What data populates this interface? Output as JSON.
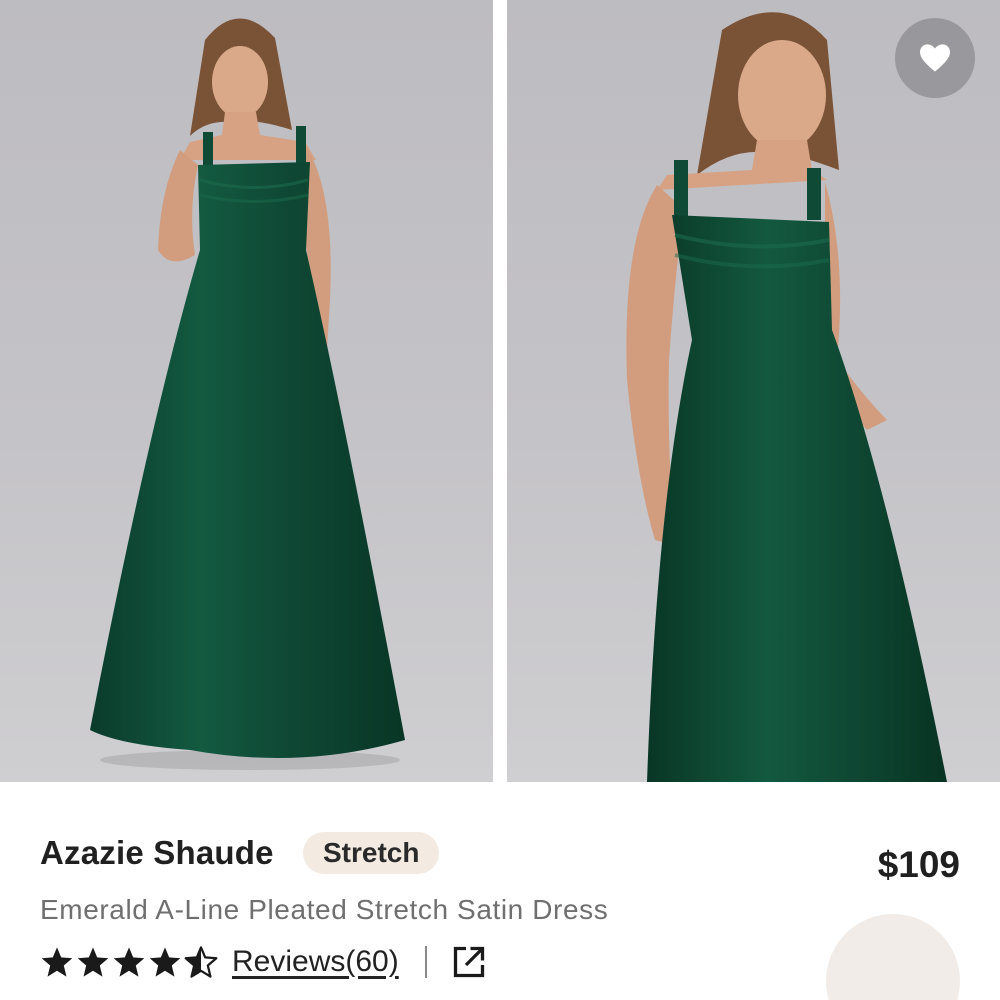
{
  "product": {
    "brand": "Azazie Shaude",
    "tag": "Stretch",
    "price": "$109",
    "title": "Emerald A-Line Pleated Stretch Satin Dress",
    "rating": 4.5,
    "reviews_label": "Reviews(60)"
  },
  "colors": {
    "dress": "#0f4a36",
    "background": "#c2c1c5",
    "tag_bg": "#f3ebe2",
    "swatch": "#f1ece7"
  },
  "icons": {
    "favorite": "heart-icon",
    "share": "share-icon",
    "rating": "star-icon"
  }
}
